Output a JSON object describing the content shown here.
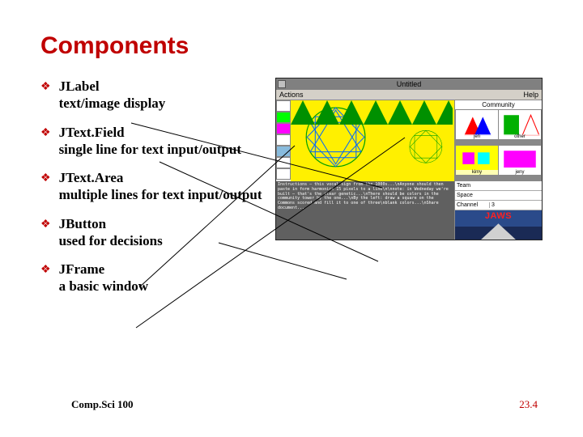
{
  "title": "Components",
  "bullets": [
    {
      "term": "JLabel",
      "desc": "text/image display"
    },
    {
      "term": "JText.Field",
      "desc": "single line for text input/output"
    },
    {
      "term": "JText.Area",
      "desc": "multiple lines for text input/output"
    },
    {
      "term": "JButton",
      "desc": "used for decisions"
    },
    {
      "term": "JFrame",
      "desc": "a basic window"
    }
  ],
  "window": {
    "title": "Untitled",
    "menu_left": "Actions",
    "menu_right": "Help",
    "community_label": "Community",
    "thumbs": [
      {
        "cap": "jen"
      },
      {
        "cap": "other"
      },
      {
        "cap": "kimy"
      },
      {
        "cap": "jeny"
      }
    ],
    "textarea": "Instructions — this vocal sign from the 1000s...\\nAnyone should then paste in form harmonics 15 pixels to a line\\n\\nnote: in Wedneday we're built — that's the clear genetic...\\nThere should be colors in the community tower by the one...\\nBy the left: draw a square on the Commons scored and fill it to one of three\\nblank colors...\\nShare document...",
    "form": [
      {
        "label": "Team",
        "value": ""
      },
      {
        "label": "Space",
        "value": ""
      },
      {
        "label": "Channel",
        "value": "3"
      }
    ],
    "jaws": "JAWS"
  },
  "footer_left": "Comp.Sci 100",
  "footer_right": "23.4"
}
